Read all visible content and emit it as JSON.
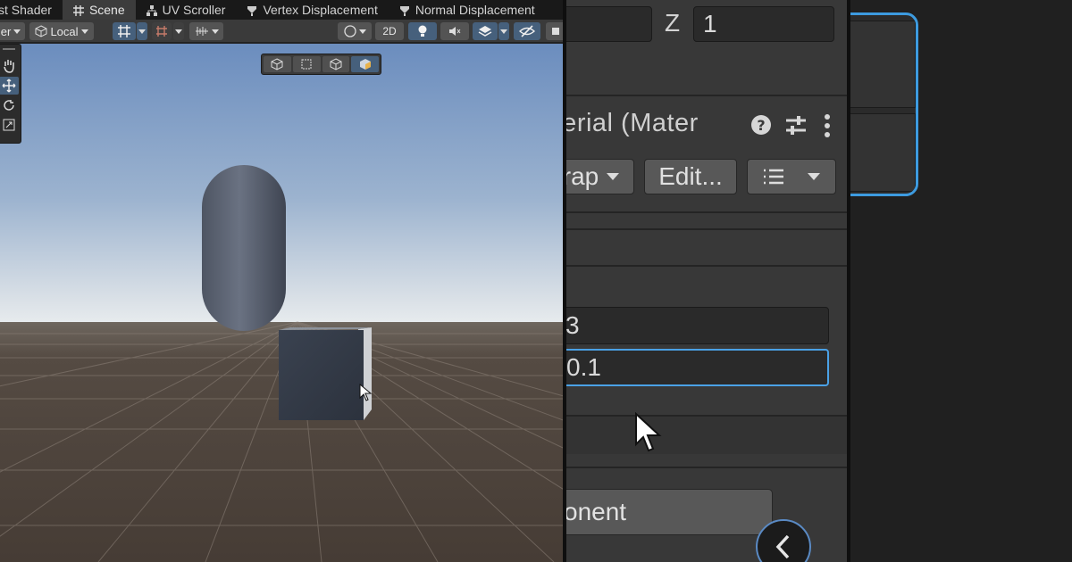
{
  "tabs": [
    {
      "label": "st Shader",
      "icon": "shader-icon",
      "active": false
    },
    {
      "label": "Scene",
      "icon": "grid-icon",
      "active": true
    },
    {
      "label": "UV Scroller",
      "icon": "hierarchy-icon",
      "active": false
    },
    {
      "label": "Vertex Displacement",
      "icon": "shader-icon",
      "active": false
    },
    {
      "label": "Normal Displacement",
      "icon": "shader-icon",
      "active": false
    }
  ],
  "toolbar": {
    "pivot_label": "er",
    "space_label": "Local",
    "mode_2d_label": "2D"
  },
  "inspector": {
    "z_label": "Z",
    "z_value": "1",
    "material_title": "aterial (Mater",
    "wrap_label": "rap",
    "edit_label": "Edit...",
    "field_top_value": "3",
    "field_focused_value": "0.1",
    "add_component_label": "onent"
  },
  "colors": {
    "accent": "#4aa1e6",
    "active_button": "#46607c",
    "panel_bg": "#383838",
    "toolbar_bg": "#3a3a3a",
    "sky_top": "#6d8fc0",
    "ground": "#4a413a"
  }
}
